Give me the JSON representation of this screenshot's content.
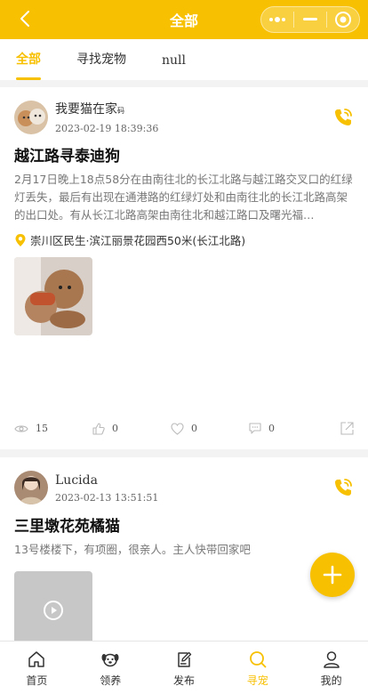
{
  "header": {
    "title": "全部"
  },
  "tabs": [
    {
      "label": "全部",
      "active": true
    },
    {
      "label": "寻找宠物",
      "active": false
    },
    {
      "label": "null",
      "active": false
    }
  ],
  "posts": [
    {
      "user": {
        "name": "我要猫在家",
        "name_suffix": "码",
        "time": "2023-02-19 18:39:36"
      },
      "title": "越江路寻泰迪狗",
      "description": "2月17日晚上18点58分在由南往北的长江北路与越江路交叉口的红绿灯丢失，最后有出现在通港路的红绿灯处和由南往北的长江北路高架的出口处。有从长江北路高架由南往北和越江路口及曙光福…",
      "location": "崇川区民生·滨江丽景花园西50米(长江北路)",
      "stats": {
        "views": "15",
        "likes": "0",
        "favorites": "0",
        "comments": "0"
      }
    },
    {
      "user": {
        "name": "Lucida",
        "time": "2023-02-13 13:51:51"
      },
      "title": "三里墩花苑橘猫",
      "description": "13号楼楼下，有项圈，很亲人。主人快带回家吧"
    }
  ],
  "bottom_nav": [
    {
      "label": "首页",
      "icon": "home-icon"
    },
    {
      "label": "领养",
      "icon": "dog-face-icon"
    },
    {
      "label": "发布",
      "icon": "edit-icon"
    },
    {
      "label": "寻宠",
      "icon": "search-icon",
      "active": true
    },
    {
      "label": "我的",
      "icon": "user-icon"
    }
  ],
  "colors": {
    "accent": "#f7c000",
    "background": "#f3f3f3"
  }
}
